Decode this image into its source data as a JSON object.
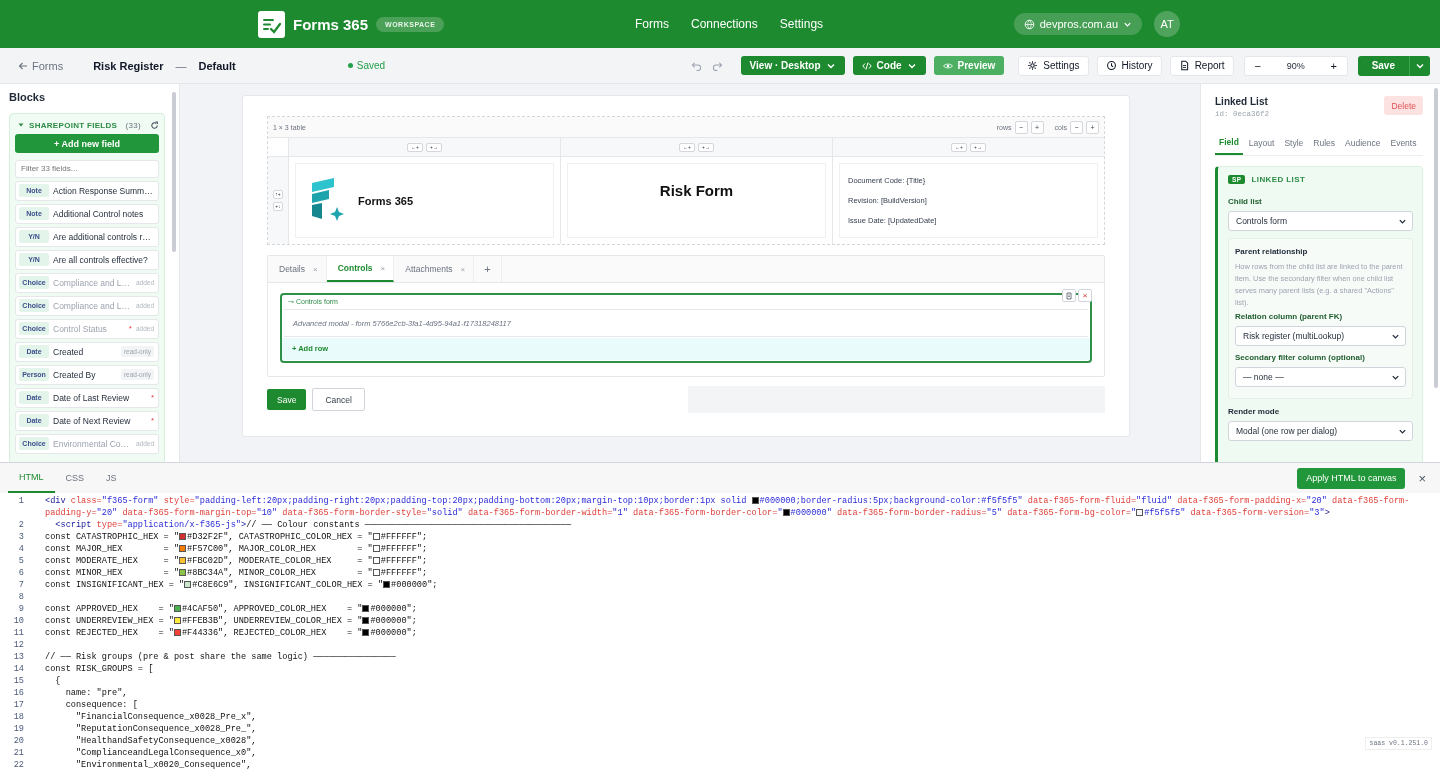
{
  "topbar": {
    "brand": "Forms 365",
    "badge": "WORKSPACE",
    "nav": [
      {
        "label": "Forms"
      },
      {
        "label": "Connections"
      },
      {
        "label": "Settings"
      }
    ],
    "tenant": "devpros.com.au",
    "avatar": "AT"
  },
  "toolbar": {
    "back": "Forms",
    "title": "Risk Register",
    "separator": "—",
    "variant": "Default",
    "status": "Saved",
    "view": "View · Desktop",
    "code": "Code",
    "preview": "Preview",
    "tools": [
      {
        "label": "Settings"
      },
      {
        "label": "History"
      },
      {
        "label": "Report"
      }
    ],
    "zoom_out": "−",
    "zoom": "90%",
    "zoom_in": "+",
    "save": "Save"
  },
  "sidebar": {
    "title": "Blocks",
    "section": {
      "title": "SHAREPOINT FIELDS",
      "count": "(33)",
      "expanded": true,
      "add_button": "+ Add new field",
      "filter_placeholder": "Filter 33 fields...",
      "fields": [
        {
          "type": "Note",
          "label": "Action Response Summ…",
          "added": false
        },
        {
          "type": "Note",
          "label": "Additional Control notes",
          "added": false
        },
        {
          "type": "Y/N",
          "label": "Are additional controls r…",
          "added": false
        },
        {
          "type": "Y/N",
          "label": "Are all controls effective?",
          "added": false
        },
        {
          "type": "Choice",
          "label": "Compliance and L…",
          "added": true,
          "note": "added"
        },
        {
          "type": "Choice",
          "label": "Compliance and L…",
          "added": true,
          "note": "added"
        },
        {
          "type": "Choice",
          "label": "Control Status",
          "added": true,
          "marker": "*",
          "note": "added"
        },
        {
          "type": "Date",
          "label": "Created",
          "added": false,
          "tag": "read-only"
        },
        {
          "type": "Person",
          "label": "Created By",
          "added": false,
          "tag": "read-only"
        },
        {
          "type": "Date",
          "label": "Date of Last Review",
          "added": false,
          "marker": "*"
        },
        {
          "type": "Date",
          "label": "Date of Next Review",
          "added": false,
          "marker": "*"
        },
        {
          "type": "Choice",
          "label": "Environmental Co…",
          "added": true,
          "note": "added"
        }
      ]
    }
  },
  "canvas": {
    "table": {
      "caption": "1 × 3 table",
      "rows_label": "rows",
      "rows_buttons": [
        "−",
        "+"
      ],
      "cols_label": "cols",
      "cols_buttons": [
        "−",
        "+"
      ],
      "columns": [
        {
          "controls": [
            "←+",
            "+→"
          ]
        },
        {
          "controls": [
            "←+",
            "+→"
          ]
        },
        {
          "controls": [
            "←+",
            "+→"
          ]
        }
      ],
      "row_controls": [
        "↑+",
        "+↓"
      ],
      "logo_text": "Forms 365",
      "title": "Risk Form",
      "meta": [
        "Document Code: {Title}",
        "Revision: [BuildVersion]",
        "Issue Date: [UpdatedDate]"
      ]
    },
    "tabs": [
      {
        "label": "Details",
        "close": "×",
        "selected": false
      },
      {
        "label": "Controls",
        "close": "×",
        "selected": true
      },
      {
        "label": "Attachments",
        "close": "×",
        "selected": false
      }
    ],
    "add_tab": "+",
    "linked_list": {
      "label": "⊸ Controls form",
      "close": "×",
      "rows": [
        "Advanced modal - form 5766e2cb-3fa1-4d95-94a1-f17318248117"
      ],
      "add_row": "+ Add row"
    },
    "save": "Save",
    "cancel": "Cancel"
  },
  "inspector": {
    "title": "Linked List",
    "id": "id: 0eca36f2",
    "delete": "Delete",
    "tabs": [
      {
        "label": "Field",
        "selected": true
      },
      {
        "label": "Layout",
        "selected": false
      },
      {
        "label": "Style",
        "selected": false
      },
      {
        "label": "Rules",
        "selected": false
      },
      {
        "label": "Audience",
        "selected": false
      },
      {
        "label": "Events",
        "selected": false
      }
    ],
    "section": {
      "badge": "SP",
      "title": "LINKED LIST",
      "child_list": {
        "label": "Child list",
        "value": "Controls form"
      },
      "relationship": {
        "title": "Parent relationship",
        "description": "How rows from the child list are linked to the parent item. Use the secondary filter when one child list serves many parent lists (e.g. a shared \"Actions\" list).",
        "relation": {
          "label": "Relation column (parent FK)",
          "value": "Risk register (multiLookup)"
        },
        "secondary": {
          "label": "Secondary filter column (optional)",
          "value": "— none —"
        }
      },
      "render_mode": {
        "label": "Render mode",
        "value": "Modal (one row per dialog)"
      }
    }
  },
  "code_panel": {
    "tabs": [
      {
        "label": "HTML",
        "selected": true
      },
      {
        "label": "CSS",
        "selected": false
      },
      {
        "label": "JS",
        "selected": false
      }
    ],
    "apply": "Apply HTML to canvas",
    "close": "×",
    "version": "saas v0.1.251.0",
    "lines": [
      {
        "number": "1",
        "segments": [
          {
            "kind": "tag",
            "text": "<div"
          },
          {
            "kind": "attr",
            "text": " class="
          },
          {
            "kind": "str",
            "text": "\"f365-form\""
          },
          {
            "kind": "attr",
            "text": " style="
          },
          {
            "kind": "str",
            "text": "\"padding-left:20px;padding-right:20px;padding-top:20px;padding-bottom:20px;margin-top:10px;border:1px solid "
          },
          {
            "kind": "swatch",
            "color": "#000000"
          },
          {
            "kind": "str",
            "text": "#000000;border-radius:5px;background-color:#f5f5f5\""
          },
          {
            "kind": "attr",
            "text": " data-f365-form-fluid="
          },
          {
            "kind": "str",
            "text": "\"fluid\""
          },
          {
            "kind": "attr",
            "text": " data-f365-form-padding-x="
          },
          {
            "kind": "str",
            "text": "\"20\""
          },
          {
            "kind": "attr",
            "text": " data-f365-form-padding-y="
          },
          {
            "kind": "str",
            "text": "\"20\""
          },
          {
            "kind": "attr",
            "text": " data-f365-form-margin-top="
          },
          {
            "kind": "str",
            "text": "\"10\""
          },
          {
            "kind": "attr",
            "text": " data-f365-form-border-style="
          },
          {
            "kind": "str",
            "text": "\"solid\""
          },
          {
            "kind": "attr",
            "text": " data-f365-form-border-width="
          },
          {
            "kind": "str",
            "text": "\"1\""
          },
          {
            "kind": "attr",
            "text": " data-f365-form-border-color="
          },
          {
            "kind": "str",
            "text": "\""
          },
          {
            "kind": "swatch",
            "color": "#000000"
          },
          {
            "kind": "str",
            "text": "#000000\""
          },
          {
            "kind": "attr",
            "text": " data-f365-form-border-radius="
          },
          {
            "kind": "str",
            "text": "\"5\""
          },
          {
            "kind": "attr",
            "text": " data-f365-form-bg-color="
          },
          {
            "kind": "str",
            "text": "\""
          },
          {
            "kind": "swatch",
            "color": "#f5f5f5"
          },
          {
            "kind": "str",
            "text": "#f5f5f5\""
          },
          {
            "kind": "attr",
            "text": " data-f365-form-version="
          },
          {
            "kind": "str",
            "text": "\"3\""
          },
          {
            "kind": "tag",
            "text": ">"
          }
        ]
      },
      {
        "number": "2",
        "segments": [
          {
            "kind": "tag",
            "text": "  <script"
          },
          {
            "kind": "attr",
            "text": " type="
          },
          {
            "kind": "str",
            "text": "\"application/x-f365-js\""
          },
          {
            "kind": "tag",
            "text": ">"
          },
          {
            "kind": "plain",
            "text": "// —— Colour constants ————————————————————————————————————————"
          }
        ]
      },
      {
        "number": "3",
        "segments": [
          {
            "kind": "plain",
            "text": "const CATASTROPHIC_HEX = \""
          },
          {
            "kind": "swatch",
            "color": "#d32f2f"
          },
          {
            "kind": "plain",
            "text": "#D32F2F\", CATASTROPHIC_COLOR_HEX = \""
          },
          {
            "kind": "swatch",
            "color": "#ffffff"
          },
          {
            "kind": "plain",
            "text": "#FFFFFF\";"
          }
        ]
      },
      {
        "number": "4",
        "segments": [
          {
            "kind": "plain",
            "text": "const MAJOR_HEX        = \""
          },
          {
            "kind": "swatch",
            "color": "#f57c00"
          },
          {
            "kind": "plain",
            "text": "#F57C00\", MAJOR_COLOR_HEX        = \""
          },
          {
            "kind": "swatch",
            "color": "#ffffff"
          },
          {
            "kind": "plain",
            "text": "#FFFFFF\";"
          }
        ]
      },
      {
        "number": "5",
        "segments": [
          {
            "kind": "plain",
            "text": "const MODERATE_HEX     = \""
          },
          {
            "kind": "swatch",
            "color": "#fbc02d"
          },
          {
            "kind": "plain",
            "text": "#FBC02D\", MODERATE_COLOR_HEX     = \""
          },
          {
            "kind": "swatch",
            "color": "#ffffff"
          },
          {
            "kind": "plain",
            "text": "#FFFFFF\";"
          }
        ]
      },
      {
        "number": "6",
        "segments": [
          {
            "kind": "plain",
            "text": "const MINOR_HEX        = \""
          },
          {
            "kind": "swatch",
            "color": "#8bc34a"
          },
          {
            "kind": "plain",
            "text": "#8BC34A\", MINOR_COLOR_HEX        = \""
          },
          {
            "kind": "swatch",
            "color": "#ffffff"
          },
          {
            "kind": "plain",
            "text": "#FFFFFF\";"
          }
        ]
      },
      {
        "number": "7",
        "segments": [
          {
            "kind": "plain",
            "text": "const INSIGNIFICANT_HEX = \""
          },
          {
            "kind": "swatch",
            "color": "#c8e6c9"
          },
          {
            "kind": "plain",
            "text": "#C8E6C9\", INSIGNIFICANT_COLOR_HEX = \""
          },
          {
            "kind": "swatch",
            "color": "#000000"
          },
          {
            "kind": "plain",
            "text": "#000000\";"
          }
        ]
      },
      {
        "number": "8"
      },
      {
        "number": "9",
        "segments": [
          {
            "kind": "plain",
            "text": "const APPROVED_HEX    = \""
          },
          {
            "kind": "swatch",
            "color": "#4caf50"
          },
          {
            "kind": "plain",
            "text": "#4CAF50\", APPROVED_COLOR_HEX    = \""
          },
          {
            "kind": "swatch",
            "color": "#000000"
          },
          {
            "kind": "plain",
            "text": "#000000\";"
          }
        ]
      },
      {
        "number": "10",
        "segments": [
          {
            "kind": "plain",
            "text": "const UNDERREVIEW_HEX = \""
          },
          {
            "kind": "swatch",
            "color": "#ffeb3b"
          },
          {
            "kind": "plain",
            "text": "#FFEB3B\", UNDERREVIEW_COLOR_HEX = \""
          },
          {
            "kind": "swatch",
            "color": "#000000"
          },
          {
            "kind": "plain",
            "text": "#000000\";"
          }
        ]
      },
      {
        "number": "11",
        "segments": [
          {
            "kind": "plain",
            "text": "const REJECTED_HEX    = \""
          },
          {
            "kind": "swatch",
            "color": "#f44336"
          },
          {
            "kind": "plain",
            "text": "#F44336\", REJECTED_COLOR_HEX    = \""
          },
          {
            "kind": "swatch",
            "color": "#000000"
          },
          {
            "kind": "plain",
            "text": "#000000\";"
          }
        ]
      },
      {
        "number": "12"
      },
      {
        "number": "13",
        "segments": [
          {
            "kind": "plain",
            "text": "// —— Risk groups (pre & post share the same logic) ————————————————"
          }
        ]
      },
      {
        "number": "14",
        "segments": [
          {
            "kind": "plain",
            "text": "const RISK_GROUPS = ["
          }
        ]
      },
      {
        "number": "15",
        "segments": [
          {
            "kind": "plain",
            "text": "  {"
          }
        ]
      },
      {
        "number": "16",
        "segments": [
          {
            "kind": "plain",
            "text": "    name: \"pre\","
          }
        ]
      },
      {
        "number": "17",
        "segments": [
          {
            "kind": "plain",
            "text": "    consequence: ["
          }
        ]
      },
      {
        "number": "18",
        "segments": [
          {
            "kind": "plain",
            "text": "      \"FinancialConsequence_x0028_Pre_x\","
          }
        ]
      },
      {
        "number": "19",
        "segments": [
          {
            "kind": "plain",
            "text": "      \"ReputationConsequence_x0028_Pre_\","
          }
        ]
      },
      {
        "number": "20",
        "segments": [
          {
            "kind": "plain",
            "text": "      \"HealthandSafetyConsequence_x0028\","
          }
        ]
      },
      {
        "number": "21",
        "segments": [
          {
            "kind": "plain",
            "text": "      \"ComplianceandLegalConsequence_x0\","
          }
        ]
      },
      {
        "number": "22",
        "segments": [
          {
            "kind": "plain",
            "text": "      \"Environmental_x0020_Consequence\","
          }
        ]
      }
    ]
  }
}
